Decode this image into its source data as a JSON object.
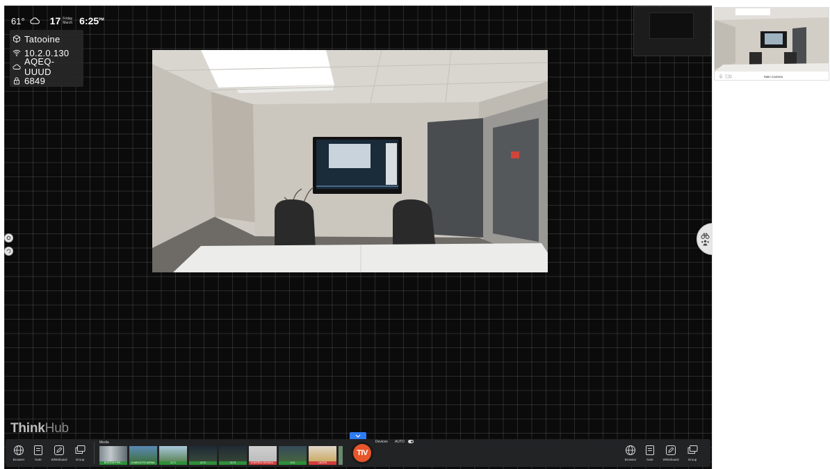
{
  "status": {
    "temperature": "61°",
    "day_number": "17",
    "weekday": "Friday",
    "month": "March",
    "time": "6:25",
    "ampm": "PM"
  },
  "info": {
    "room_name": "Tatooine",
    "ip_address": "10.2.0.130",
    "cloud_code": "AQEQ-UUUD",
    "pin": "6849"
  },
  "brand": {
    "think": "Think",
    "hub": "Hub"
  },
  "sidebar": {
    "camera_label": "Main Camera"
  },
  "toolbar": {
    "left_tools": [
      {
        "label": "Browser",
        "icon": "globe-icon"
      },
      {
        "label": "Note",
        "icon": "note-icon"
      },
      {
        "label": "Whiteboard",
        "icon": "pencil-icon"
      },
      {
        "label": "Group",
        "icon": "group-windows-icon"
      }
    ],
    "right_tools": [
      {
        "label": "Browser",
        "icon": "globe-icon"
      },
      {
        "label": "Note",
        "icon": "note-icon"
      },
      {
        "label": "Whiteboard",
        "icon": "pencil-icon"
      },
      {
        "label": "Group",
        "icon": "group-windows-icon"
      }
    ],
    "media_label": "Media",
    "media_items": [
      {
        "caption": "BOSTON PIPE...",
        "color": "#2f8f3a"
      },
      {
        "caption": "CHARLOTTE AERIAL",
        "color": "#2f8f3a"
      },
      {
        "caption": "CLT1",
        "color": "#2f8f3a"
      },
      {
        "caption": "CLT2",
        "color": "#2f8f3a"
      },
      {
        "caption": "CLT3",
        "color": "#2f8f3a"
      },
      {
        "caption": "CONTROL ROOM 8...",
        "color": "#d23c3c"
      },
      {
        "caption": "CV1",
        "color": "#2f8f3a"
      },
      {
        "caption": "LAGOS",
        "color": "#d23c3c"
      }
    ],
    "devices_label": "Devices",
    "auto_label": "AUTO",
    "logo_text": "TIV"
  }
}
